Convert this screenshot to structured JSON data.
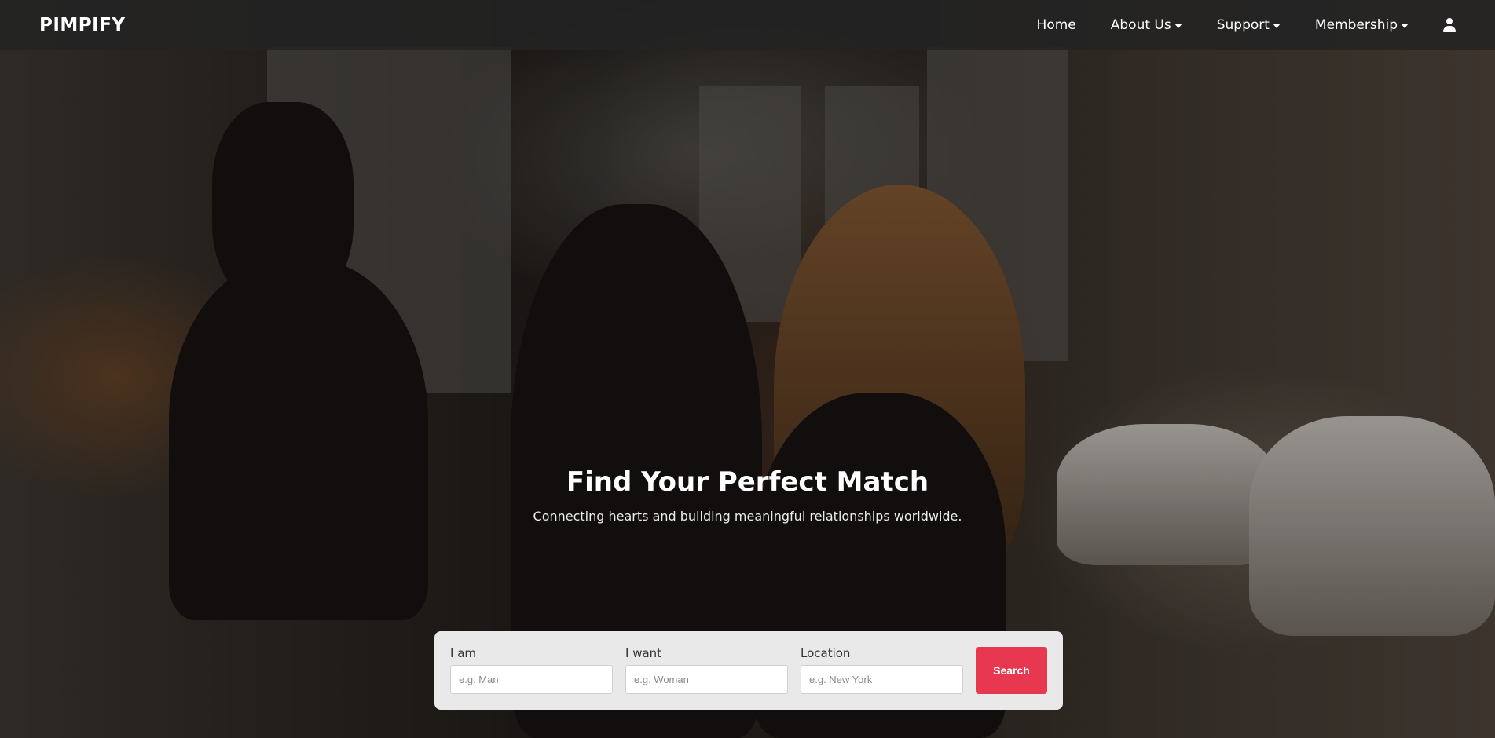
{
  "navbar": {
    "brand": "PIMPIFY",
    "items": [
      {
        "label": "Home",
        "has_dropdown": false
      },
      {
        "label": "About Us",
        "has_dropdown": true
      },
      {
        "label": "Support",
        "has_dropdown": true
      },
      {
        "label": "Membership",
        "has_dropdown": true
      }
    ],
    "user_icon": "user-icon"
  },
  "hero": {
    "title": "Find Your Perfect Match",
    "subtitle": "Connecting hearts and building meaningful relationships worldwide."
  },
  "search": {
    "fields": [
      {
        "label": "I am",
        "placeholder": "e.g. Man"
      },
      {
        "label": "I want",
        "placeholder": "e.g. Woman"
      },
      {
        "label": "Location",
        "placeholder": "e.g. New York"
      }
    ],
    "button_label": "Search"
  },
  "colors": {
    "accent": "#e8384f",
    "navbar_bg": "#232323",
    "card_bg": "#e9e9e9"
  }
}
